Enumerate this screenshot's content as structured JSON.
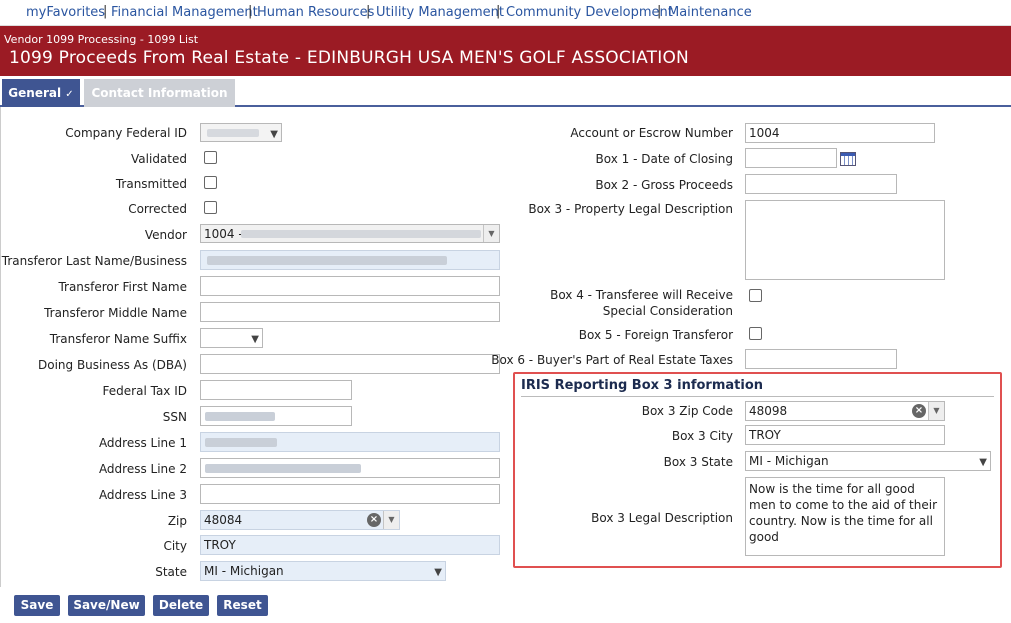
{
  "nav": {
    "items": [
      "myFavorites",
      "Financial Management",
      "Human Resources",
      "Utility Management",
      "Community Development",
      "Maintenance"
    ],
    "separator": "|"
  },
  "banner": {
    "breadcrumb": "Vendor 1099 Processing - 1099 List",
    "title": "1099 Proceeds From Real Estate - EDINBURGH USA MEN'S GOLF ASSOCIATION"
  },
  "tabs": {
    "general": "General",
    "general_check": "✓",
    "contact": "Contact Information"
  },
  "left": {
    "company_federal_id": "Company Federal ID",
    "validated": "Validated",
    "transmitted": "Transmitted",
    "corrected": "Corrected",
    "vendor": "Vendor",
    "vendor_value": "1004 -",
    "transferor_last": "Transferor Last Name/Business",
    "transferor_first": "Transferor First Name",
    "transferor_middle": "Transferor Middle Name",
    "transferor_suffix": "Transferor Name Suffix",
    "dba": "Doing Business As (DBA)",
    "federal_tax_id": "Federal Tax ID",
    "ssn": "SSN",
    "address1": "Address Line 1",
    "address2": "Address Line 2",
    "address3": "Address Line 3",
    "zip": "Zip",
    "zip_value": "48084",
    "city": "City",
    "city_value": "TROY",
    "state": "State",
    "state_value": "MI - Michigan"
  },
  "right": {
    "account": "Account or Escrow Number",
    "account_value": "1004",
    "box1": "Box 1 - Date of Closing",
    "box2": "Box 2 - Gross Proceeds",
    "box3": "Box 3 - Property Legal Description",
    "box4_line1": "Box 4 - Transferee will Receive",
    "box4_line2": "Special Consideration",
    "box5": "Box 5 - Foreign Transferor",
    "box6": "Box 6 - Buyer's Part of Real Estate Taxes"
  },
  "iris": {
    "title": "IRIS Reporting Box 3 information",
    "zip_label": "Box 3 Zip Code",
    "zip_value": "48098",
    "city_label": "Box 3 City",
    "city_value": "TROY",
    "state_label": "Box 3 State",
    "state_value": "MI - Michigan",
    "legal_label": "Box 3 Legal Description",
    "legal_value": "Now is the time for all good men to come to the aid of their country. Now is the time for all good"
  },
  "buttons": {
    "save": "Save",
    "save_new": "Save/New",
    "delete": "Delete",
    "reset": "Reset"
  },
  "icons": {
    "clear": "clear-x-icon",
    "calendar": "calendar-icon",
    "dropdown": "chevron-down-icon",
    "checkmark": "checkmark-icon"
  },
  "colors": {
    "banner": "#9b1b24",
    "tab_active": "#3f5592",
    "nav_link": "#2a55a0",
    "highlight_border": "#e05050"
  }
}
